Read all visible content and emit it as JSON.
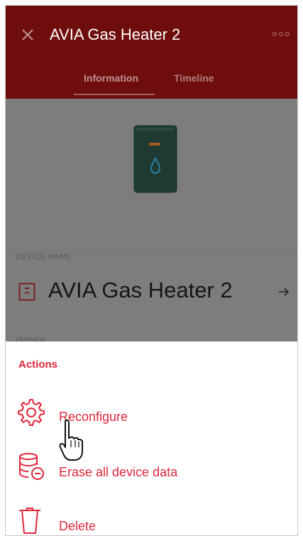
{
  "header": {
    "title": "AVIA Gas Heater 2",
    "tabs": [
      {
        "label": "Information",
        "active": true
      },
      {
        "label": "Timeline",
        "active": false
      }
    ]
  },
  "device": {
    "section_label": "DEVICE NAME",
    "name": "AVIA Gas Heater 2",
    "owner_label": "OWNER"
  },
  "actions_sheet": {
    "title": "Actions",
    "items": [
      {
        "label": "Reconfigure",
        "icon": "gear-icon"
      },
      {
        "label": "Erase all device data",
        "icon": "database-erase-icon"
      },
      {
        "label": "Delete",
        "icon": "trash-icon"
      }
    ]
  },
  "colors": {
    "header_bg": "#6f0d0d",
    "accent": "#e0263a",
    "overlay": "#7d7d7d"
  }
}
